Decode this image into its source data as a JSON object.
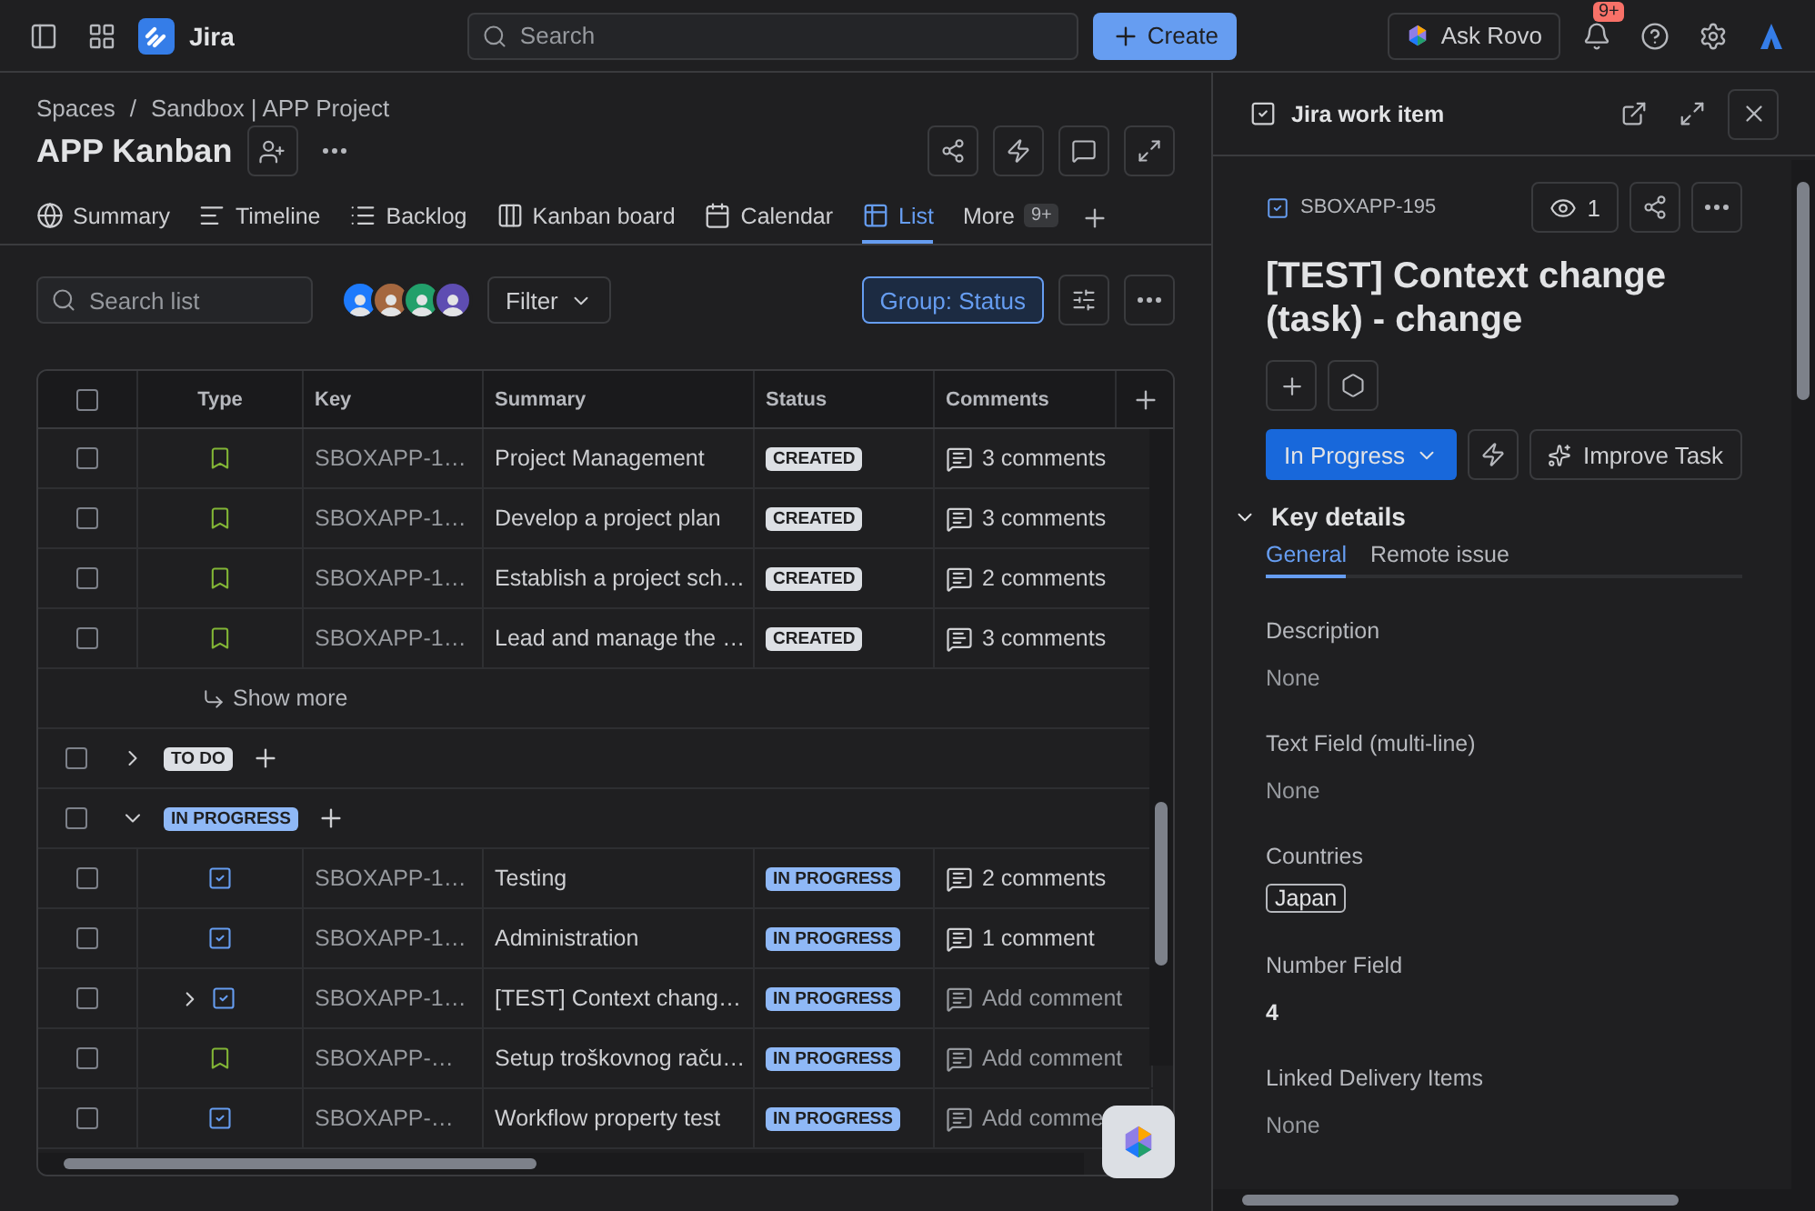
{
  "topbar": {
    "product": "Jira",
    "search": {
      "placeholder": "Search"
    },
    "create": "Create",
    "ask_rovo": "Ask Rovo",
    "notifications": "9+"
  },
  "breadcrumbs": {
    "items": [
      "Spaces",
      "Sandbox | APP Project"
    ],
    "separator": "/"
  },
  "title": "APP Kanban",
  "tabs": [
    {
      "label": "Summary",
      "selected": false
    },
    {
      "label": "Timeline",
      "selected": false
    },
    {
      "label": "Backlog",
      "selected": false
    },
    {
      "label": "Kanban board",
      "selected": false
    },
    {
      "label": "Calendar",
      "selected": false
    },
    {
      "label": "List",
      "selected": true
    },
    {
      "label": "More",
      "selected": false,
      "count": "9+"
    }
  ],
  "toolbar": {
    "search": {
      "placeholder": "Search list"
    },
    "filter": "Filter",
    "group": "Group: Status"
  },
  "table": {
    "select_all": {
      "checked": false
    },
    "columns": [
      "Type",
      "Key",
      "Summary",
      "Status",
      "Comments"
    ],
    "groups": [
      {
        "rows": [
          {
            "kind": "story",
            "key": "SBOXAPP-1…",
            "summary": "Project Management",
            "status": {
              "label": "CREATED",
              "color": "#dcdfe4"
            },
            "comments": "3 comments",
            "has_comments": true,
            "checked": false,
            "has_children": false
          },
          {
            "kind": "story",
            "key": "SBOXAPP-1…",
            "summary": "Develop a project plan",
            "status": {
              "label": "CREATED",
              "color": "#dcdfe4"
            },
            "comments": "3 comments",
            "has_comments": true,
            "checked": false,
            "has_children": false
          },
          {
            "kind": "story",
            "key": "SBOXAPP-1…",
            "summary": "Establish a project sch…",
            "status": {
              "label": "CREATED",
              "color": "#dcdfe4"
            },
            "comments": "2 comments",
            "has_comments": true,
            "checked": false,
            "has_children": false
          },
          {
            "kind": "story",
            "key": "SBOXAPP-1…",
            "summary": "Lead and manage the …",
            "status": {
              "label": "CREATED",
              "color": "#dcdfe4"
            },
            "comments": "3 comments",
            "has_comments": true,
            "checked": false,
            "has_children": false
          }
        ],
        "show_more": "Show more"
      },
      {
        "label": "TO DO",
        "color": "#dcdfe4",
        "expanded": false,
        "checked": false
      },
      {
        "label": "IN PROGRESS",
        "color": "#8fb8f6",
        "expanded": true,
        "checked": false,
        "rows": [
          {
            "kind": "task",
            "key": "SBOXAPP-1…",
            "summary": "Testing",
            "status": {
              "label": "IN PROGRESS",
              "color": "#8fb8f6"
            },
            "comments": "2 comments",
            "has_comments": true,
            "checked": false,
            "has_children": false
          },
          {
            "kind": "task",
            "key": "SBOXAPP-1…",
            "summary": "Administration",
            "status": {
              "label": "IN PROGRESS",
              "color": "#8fb8f6"
            },
            "comments": "1 comment",
            "has_comments": true,
            "checked": false,
            "has_children": false
          },
          {
            "kind": "task",
            "key": "SBOXAPP-1…",
            "summary": "[TEST] Context chang…",
            "status": {
              "label": "IN PROGRESS",
              "color": "#8fb8f6"
            },
            "comments": "Add comment",
            "has_comments": false,
            "checked": false,
            "has_children": true
          },
          {
            "kind": "story",
            "key": "SBOXAPP-…",
            "summary": "Setup troškovnog raču…",
            "status": {
              "label": "IN PROGRESS",
              "color": "#8fb8f6"
            },
            "comments": "Add comment",
            "has_comments": false,
            "checked": false,
            "has_children": false
          },
          {
            "kind": "task",
            "key": "SBOXAPP-…",
            "summary": "Workflow property test",
            "status": {
              "label": "IN PROGRESS",
              "color": "#8fb8f6"
            },
            "comments": "Add comme",
            "has_comments": false,
            "checked": false,
            "has_children": false
          }
        ]
      }
    ]
  },
  "detail": {
    "header": "Jira work item",
    "key": "SBOXAPP-195",
    "watchers": "1",
    "title": "[TEST] Context change (task) - change",
    "status": "In Progress",
    "improve": "Improve Task",
    "section": {
      "title": "Key details",
      "expanded": true
    },
    "tabs": [
      {
        "label": "General",
        "selected": true
      },
      {
        "label": "Remote issue",
        "selected": false
      }
    ],
    "fields": [
      {
        "label": "Description",
        "value": "None",
        "kind": "empty"
      },
      {
        "label": "Text Field (multi-line)",
        "value": "None",
        "kind": "empty"
      },
      {
        "label": "Countries",
        "value": "Japan",
        "kind": "tag"
      },
      {
        "label": "Number Field",
        "value": "4",
        "kind": "text"
      },
      {
        "label": "Linked Delivery Items",
        "value": "None",
        "kind": "empty"
      }
    ]
  }
}
